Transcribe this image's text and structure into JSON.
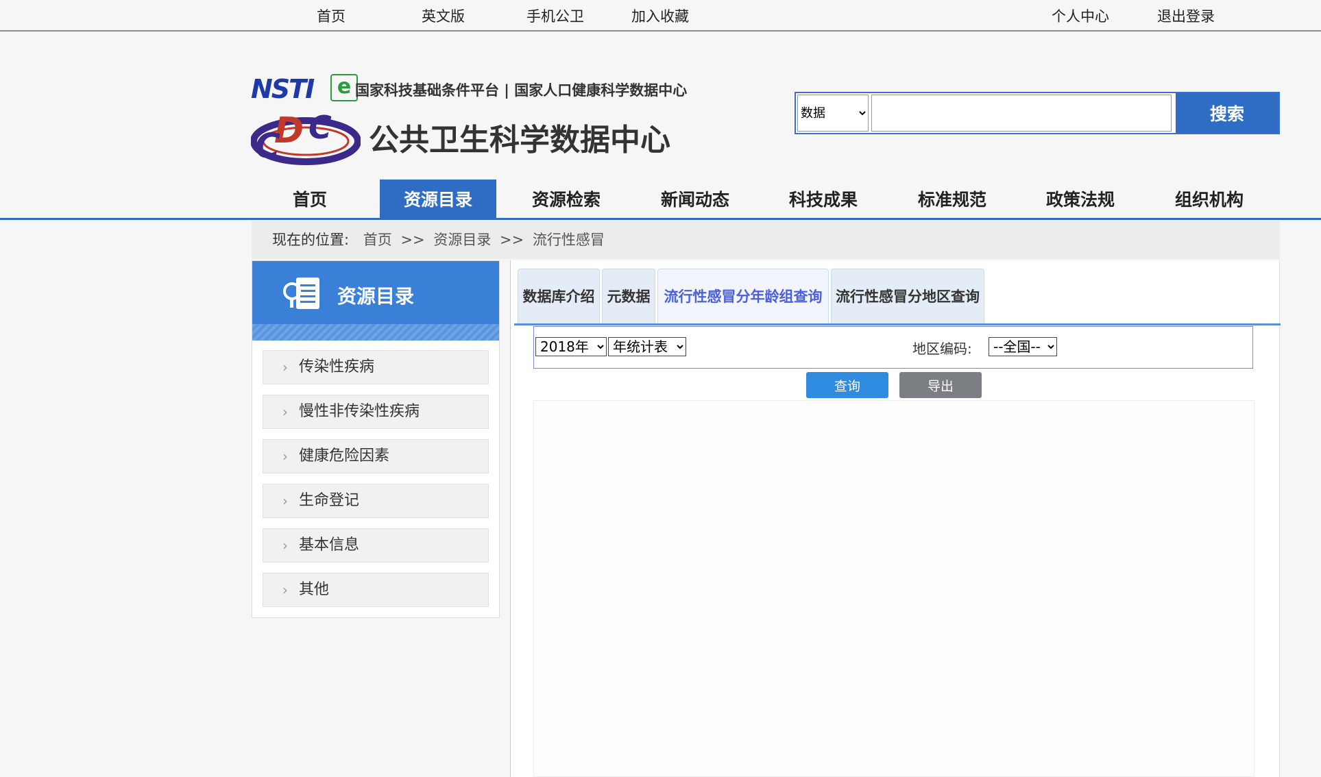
{
  "topbar": {
    "links": [
      "首页",
      "英文版",
      "手机公卫",
      "加入收藏"
    ],
    "user_links": [
      "个人中心",
      "退出登录"
    ]
  },
  "header": {
    "platform_text": "国家科技基础条件平台 | 国家人口健康科学数据中心",
    "site_title": "公共卫生科学数据中心",
    "logo_nsti": "NSTI",
    "logo_e": "e"
  },
  "search": {
    "scope_options": [
      "数据"
    ],
    "scope_selected": "数据",
    "query_value": "",
    "button_label": "搜索"
  },
  "nav": {
    "items": [
      "首页",
      "资源目录",
      "资源检索",
      "新闻动态",
      "科技成果",
      "标准规范",
      "政策法规",
      "组织机构"
    ],
    "active_index": 1
  },
  "breadcrumb": {
    "label": "现在的位置:",
    "path": [
      "首页",
      ">>",
      "资源目录",
      ">>",
      "流行性感冒"
    ]
  },
  "sidebar": {
    "title": "资源目录",
    "items": [
      "传染性疾病",
      "慢性非传染性疾病",
      "健康危险因素",
      "生命登记",
      "基本信息",
      "其他"
    ]
  },
  "tabs": {
    "items": [
      "数据库介绍",
      "元数据",
      "流行性感冒分年龄组查询",
      "流行性感冒分地区查询"
    ],
    "active_index": 2
  },
  "filters": {
    "year_selected": "2018年",
    "report_type_selected": "年统计表",
    "region_label": "地区编码:",
    "region_selected": "--全国--"
  },
  "buttons": {
    "query_label": "查询",
    "export_label": "导出"
  },
  "colors": {
    "primary_blue": "#2f6dc5",
    "active_tab_text": "#4a5fe0",
    "query_button": "#2f8be0",
    "export_button": "#7b7f84"
  }
}
